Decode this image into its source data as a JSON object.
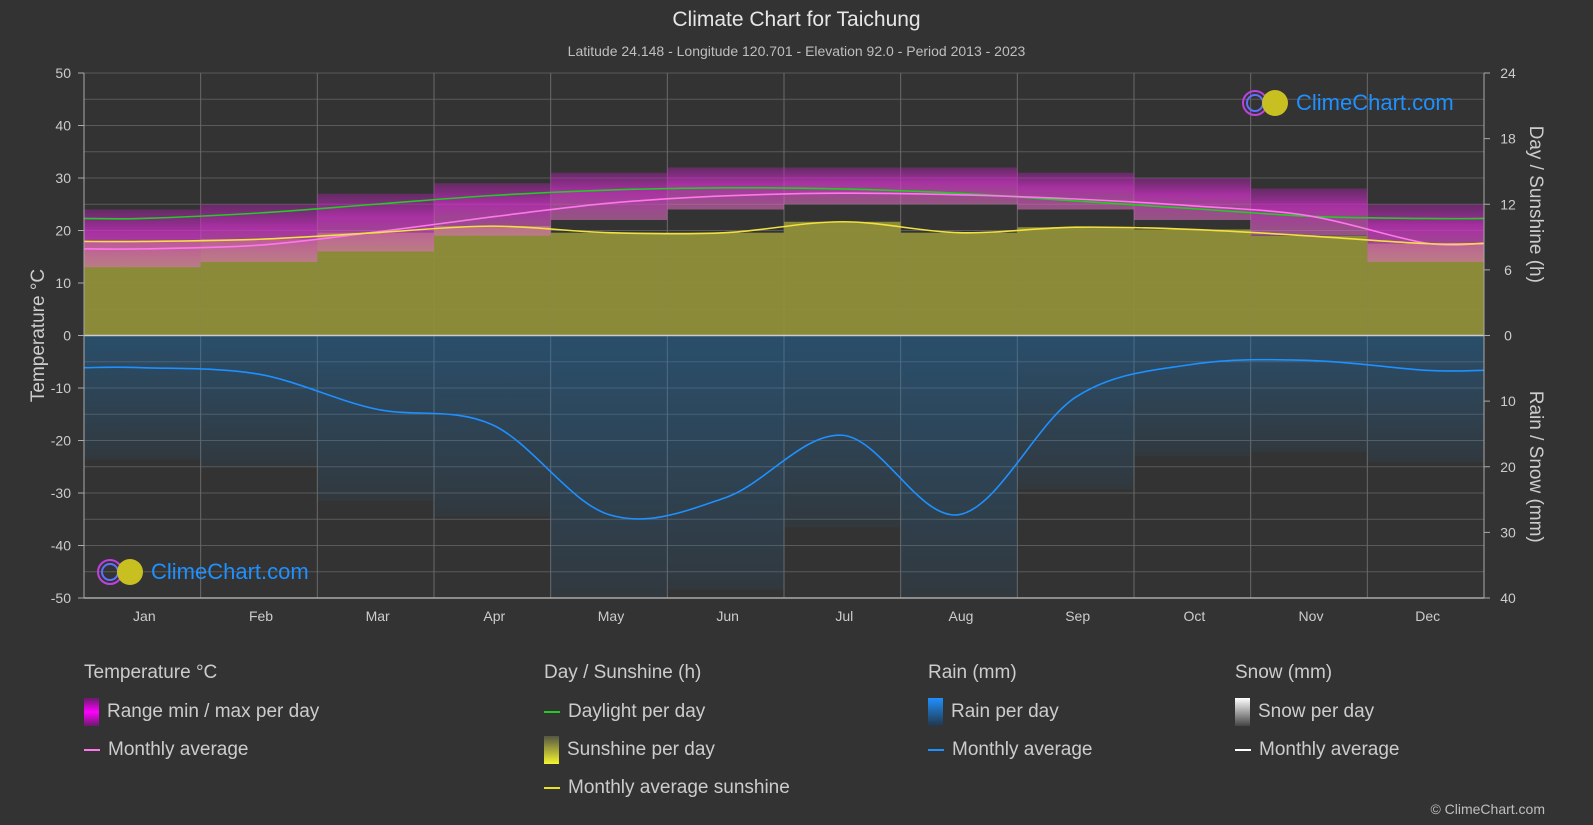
{
  "header": {
    "title": "Climate Chart for Taichung",
    "subtitle": "Latitude 24.148 - Longitude 120.701 - Elevation 92.0 - Period 2013 - 2023"
  },
  "logo_text": "ClimeChart.com",
  "copyright": "© ClimeChart.com",
  "colors": {
    "background": "#333333",
    "temperature_range": "#e020e0",
    "temperature_avg": "#ff77ee",
    "daylight": "#22cc22",
    "sunshine_fill": "#a8a83a",
    "sunshine_avg": "#f0e040",
    "rain_fill": "#1f6fa8",
    "rain_avg": "#1e90ff",
    "snow_avg": "#ffffff",
    "grid": "#5a5a5a"
  },
  "legend": {
    "temperature": {
      "title": "Temperature °C",
      "items": [
        "Range min / max per day",
        "Monthly average"
      ]
    },
    "sunshine": {
      "title": "Day / Sunshine (h)",
      "items": [
        "Daylight per day",
        "Sunshine per day",
        "Monthly average sunshine"
      ]
    },
    "rain": {
      "title": "Rain (mm)",
      "items": [
        "Rain per day",
        "Monthly average"
      ]
    },
    "snow": {
      "title": "Snow (mm)",
      "items": [
        "Snow per day",
        "Monthly average"
      ]
    }
  },
  "chart_data": {
    "type": "line",
    "title": "Climate Chart for Taichung",
    "categories": [
      "Jan",
      "Feb",
      "Mar",
      "Apr",
      "May",
      "Jun",
      "Jul",
      "Aug",
      "Sep",
      "Oct",
      "Nov",
      "Dec"
    ],
    "left_axis": {
      "label": "Temperature °C",
      "range": [
        -50,
        50
      ],
      "ticks": [
        50,
        40,
        30,
        20,
        10,
        0,
        -10,
        -20,
        -30,
        -40,
        -50
      ]
    },
    "right_axis_top": {
      "label": "Day / Sunshine (h)",
      "range": [
        0,
        24
      ],
      "ticks": [
        24,
        18,
        12,
        6,
        0
      ]
    },
    "right_axis_bottom": {
      "label": "Rain / Snow (mm)",
      "range": [
        0,
        40
      ],
      "ticks": [
        0,
        10,
        20,
        30,
        40
      ]
    },
    "grid": true,
    "series": [
      {
        "name": "Temperature monthly average",
        "axis": "temperature",
        "values": [
          16.5,
          17.2,
          19.7,
          22.6,
          25.2,
          26.6,
          27.1,
          26.8,
          26.0,
          24.7,
          22.8,
          17.6
        ]
      },
      {
        "name": "Temperature range max (approx)",
        "axis": "temperature",
        "values": [
          24,
          25,
          27,
          29,
          31,
          32,
          32,
          32,
          31,
          30,
          28,
          25
        ]
      },
      {
        "name": "Temperature range min (approx)",
        "axis": "temperature",
        "values": [
          13,
          14,
          16,
          19,
          22,
          24,
          25,
          25,
          24,
          22,
          19,
          14
        ]
      },
      {
        "name": "Daylight per day",
        "axis": "sunshine",
        "values": [
          10.7,
          11.2,
          12.0,
          12.8,
          13.3,
          13.5,
          13.4,
          13.0,
          12.3,
          11.6,
          10.9,
          10.7
        ]
      },
      {
        "name": "Monthly average sunshine",
        "axis": "sunshine",
        "values": [
          8.6,
          8.8,
          9.4,
          10.0,
          9.4,
          9.4,
          10.4,
          9.4,
          9.9,
          9.7,
          9.1,
          8.4
        ]
      },
      {
        "name": "Rain monthly average",
        "axis": "rain",
        "values": [
          4.9,
          5.9,
          11.2,
          13.6,
          27.3,
          24.7,
          15.2,
          27.3,
          9.4,
          4.4,
          3.8,
          5.3
        ]
      },
      {
        "name": "Snow monthly average",
        "axis": "rain",
        "values": [
          0,
          0,
          0,
          0,
          0,
          0,
          0,
          0,
          0,
          0,
          0,
          0
        ]
      }
    ]
  }
}
